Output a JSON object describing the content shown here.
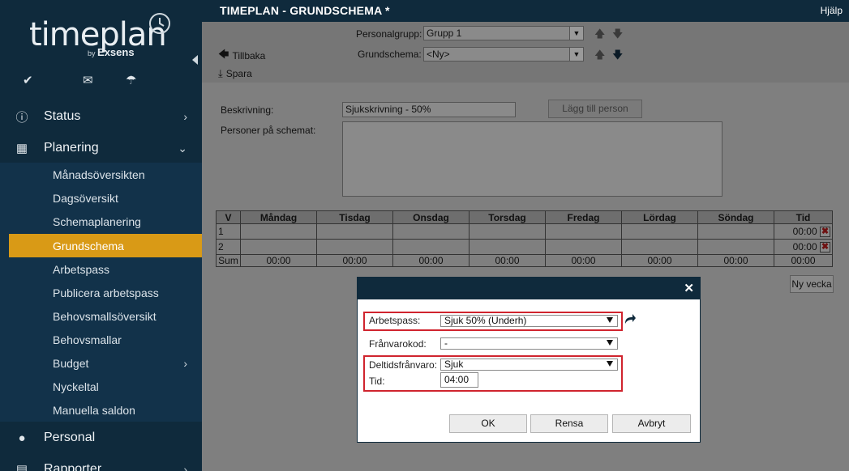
{
  "sidebar": {
    "logo": {
      "brand": "timeplan",
      "by": "by",
      "company": "Exsens"
    },
    "quick_icons": [
      "check-icon",
      "mail-icon",
      "umbrella-icon"
    ],
    "nav": [
      {
        "label": "Status",
        "icon": "info-icon"
      },
      {
        "label": "Planering",
        "icon": "calendar-icon"
      },
      {
        "label": "Personal",
        "icon": "person-icon"
      },
      {
        "label": "Rapporter",
        "icon": "report-icon"
      }
    ],
    "submenu": [
      "Månadsöversikten",
      "Dagsöversikt",
      "Schemaplanering",
      "Grundschema",
      "Arbetspass",
      "Publicera arbetspass",
      "Behovsmallsöversikt",
      "Behovsmallar",
      "Budget",
      "Nyckeltal",
      "Manuella saldon"
    ],
    "active_item": "Grundschema"
  },
  "header": {
    "title": "TIMEPLAN - GRUNDSCHEMA *",
    "help": "Hjälp"
  },
  "toolbar": {
    "back": "Tillbaka",
    "save": "Spara",
    "personalgrupp_label": "Personalgrupp:",
    "personalgrupp_value": "Grupp 1",
    "grundschema_label": "Grundschema:",
    "grundschema_value": "<Ny>"
  },
  "form": {
    "description_label": "Beskrivning:",
    "description_value": "Sjukskrivning - 50%",
    "add_person": "Lägg till person",
    "persons_label": "Personer på schemat:"
  },
  "schedule": {
    "headers": [
      "V",
      "Måndag",
      "Tisdag",
      "Onsdag",
      "Torsdag",
      "Fredag",
      "Lördag",
      "Söndag",
      "Tid"
    ],
    "rows": [
      {
        "week": "1",
        "time": "00:00"
      },
      {
        "week": "2",
        "time": "00:00"
      }
    ],
    "sum_row": [
      "Sum",
      "00:00",
      "00:00",
      "00:00",
      "00:00",
      "00:00",
      "00:00",
      "00:00",
      "00:00"
    ],
    "new_week": "Ny vecka"
  },
  "modal": {
    "arbetspass_label": "Arbetspass:",
    "arbetspass_value": "Sjuk 50% (Underh)",
    "franvarokod_label": "Frånvarokod:",
    "franvarokod_value": "-",
    "deltid_label": "Deltidsfrånvaro:",
    "deltid_value": "Sjuk",
    "tid_label": "Tid:",
    "tid_value": "04:00",
    "ok": "OK",
    "rensa": "Rensa",
    "avbryt": "Avbryt"
  },
  "colors": {
    "sidebar": "#0f2a3c",
    "active": "#d99a16",
    "highlight": "#d0242e"
  }
}
